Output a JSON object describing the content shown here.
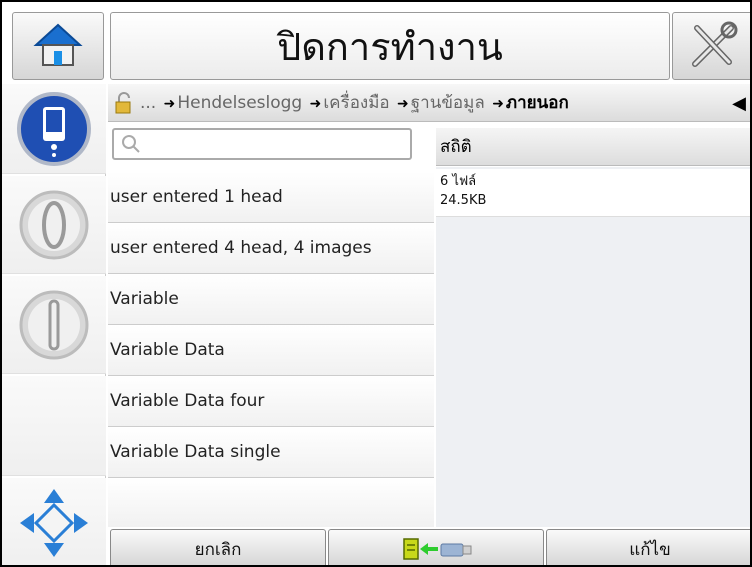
{
  "header": {
    "title": "ปิดการทำงาน",
    "home_icon": "home-icon",
    "tools_icon": "tools-icon"
  },
  "breadcrumb": {
    "items": [
      "...",
      "Hendelseslogg",
      "เครื่องมือ",
      "ฐานข้อมูล",
      "ภายนอก"
    ],
    "lock_icon": "lock-icon",
    "back_icon": "triangle-left-icon"
  },
  "search": {
    "value": "",
    "placeholder": ""
  },
  "files": [
    "user entered 1 head",
    "user entered 4 head, 4 images",
    "Variable",
    "Variable Data",
    "Variable Data four",
    "Variable Data single"
  ],
  "stats": {
    "header": "สถิติ",
    "count": "6 ไฟล์",
    "size": "24.5KB"
  },
  "bottom": {
    "cancel": "ยกเลิก",
    "transfer_icon": "file-to-usb-icon",
    "edit": "แก้ไข"
  },
  "colors": {
    "status_blue": "#1f4fb3",
    "nav_blue": "#2a7fd6",
    "transfer_green": "#2ecc2e",
    "file_yellow": "#c8d91a"
  }
}
